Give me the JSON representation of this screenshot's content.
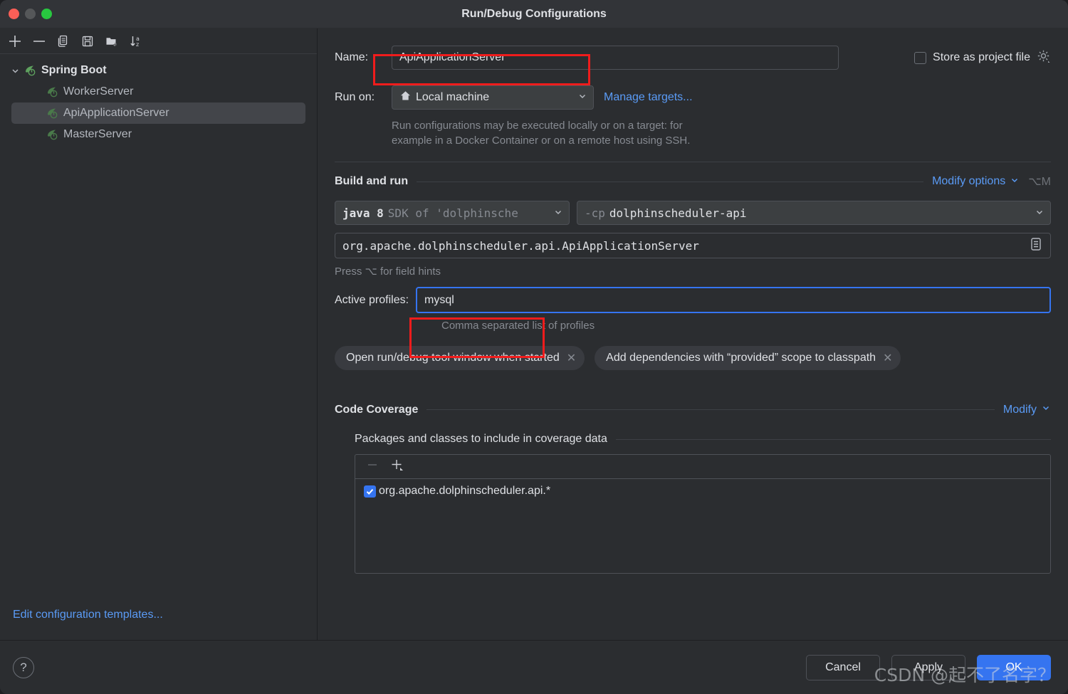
{
  "window": {
    "title": "Run/Debug Configurations",
    "traffic_lights": [
      "close",
      "minimize",
      "zoom"
    ]
  },
  "sidebar": {
    "toolbar": [
      {
        "name": "add-configuration-button",
        "icon": "plus-icon"
      },
      {
        "name": "remove-configuration-button",
        "icon": "minus-icon"
      },
      {
        "name": "copy-configuration-button",
        "icon": "copy-icon"
      },
      {
        "name": "save-configuration-button",
        "icon": "save-icon"
      },
      {
        "name": "new-folder-button",
        "icon": "new-folder-icon"
      },
      {
        "name": "sort-configurations-button",
        "icon": "sort-alpha-icon"
      }
    ],
    "tree": {
      "root": {
        "label": "Spring Boot",
        "icon": "spring-boot-icon",
        "expanded": true
      },
      "children": [
        {
          "label": "WorkerServer",
          "icon": "spring-boot-icon",
          "selected": false
        },
        {
          "label": "ApiApplicationServer",
          "icon": "spring-boot-icon",
          "selected": true
        },
        {
          "label": "MasterServer",
          "icon": "spring-boot-icon",
          "selected": false
        }
      ]
    },
    "edit_templates_link": "Edit configuration templates..."
  },
  "form": {
    "name_label": "Name:",
    "name_value": "ApiApplicationServer",
    "store_as_project_file_label": "Store as project file",
    "store_as_project_file_checked": false,
    "store_gear_icon": "gear-icon",
    "run_on_label": "Run on:",
    "run_on_value": "Local machine",
    "run_on_icon": "home-icon",
    "manage_targets_link": "Manage targets...",
    "run_on_description_line1": "Run configurations may be executed locally or on a target: for",
    "run_on_description_line2": "example in a Docker Container or on a remote host using SSH."
  },
  "build_and_run": {
    "section_title": "Build and run",
    "modify_options_link": "Modify options",
    "modify_options_shortcut": "⌥M",
    "sdk_bold": "java 8",
    "sdk_dim": "SDK of 'dolphinsche",
    "classpath_prefix": "-cp",
    "classpath_value": "dolphinscheduler-api",
    "main_class_value": "org.apache.dolphinscheduler.api.ApiApplicationServer",
    "main_class_browse_icon": "document-list-icon",
    "field_hints": "Press ⌥ for field hints",
    "active_profiles_label": "Active profiles:",
    "active_profiles_value": "mysql",
    "active_profiles_hint": "Comma separated list of profiles",
    "chips": [
      {
        "label": "Open run/debug tool window when started",
        "close_icon": "close-icon"
      },
      {
        "label": "Add dependencies with “provided” scope to classpath",
        "close_icon": "close-icon"
      }
    ]
  },
  "code_coverage": {
    "section_title": "Code Coverage",
    "modify_link": "Modify",
    "packages_title": "Packages and classes to include in coverage data",
    "toolbar": [
      {
        "name": "remove-package-button",
        "icon": "minus-icon",
        "enabled": false
      },
      {
        "name": "add-package-button",
        "icon": "plus-dropdown-icon",
        "enabled": true
      }
    ],
    "items": [
      {
        "label": "org.apache.dolphinscheduler.api.*",
        "checked": true
      }
    ]
  },
  "footer": {
    "help_icon": "question-mark-icon",
    "cancel_label": "Cancel",
    "apply_label": "Apply",
    "ok_label": "OK"
  },
  "watermark": "CSDN @起不了名字？",
  "colors": {
    "accent": "#3574f0",
    "link": "#5a9bf6",
    "annotation": "#f01c1c",
    "window_bg": "#2b2d30",
    "titlebar_bg": "#323438"
  }
}
